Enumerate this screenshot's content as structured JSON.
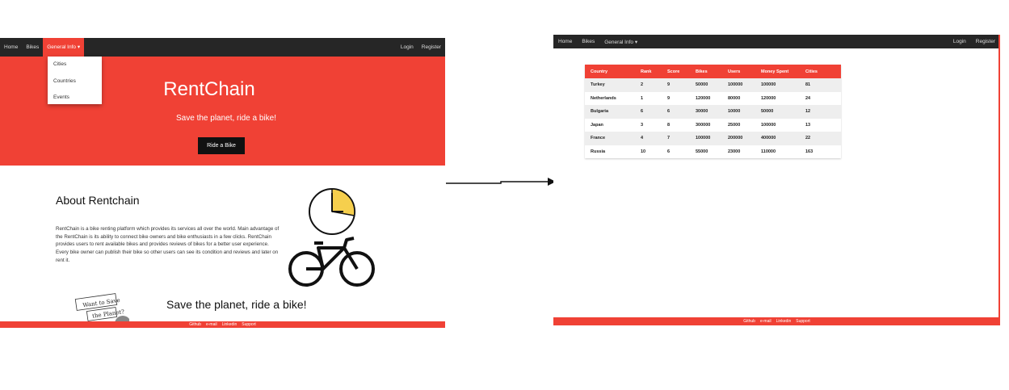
{
  "left": {
    "nav": {
      "items": [
        "Home",
        "Bikes",
        "General Info ▾"
      ],
      "right": [
        "Login",
        "Register"
      ]
    },
    "dropdown": [
      "Cities",
      "Countries",
      "Events"
    ],
    "hero": {
      "title": "RentChain",
      "subtitle": "Save the planet, ride a bike!",
      "button": "Ride a Bike"
    },
    "about": {
      "title": "About Rentchain",
      "text": "RentChain is a bike renting platform which provides its services all over the world. Main advantage of the RentChain is its ability to connect bike owners and bike enthusiasts in a few clicks. RentChain provides users to rent available bikes and provides reviews of bikes for a better user experience. Every bike owner can publish their bike so other users can see its condition and reviews and later on rent it."
    },
    "stamp": [
      "Want to Save",
      "the Planet?"
    ],
    "tagline": "Save the planet, ride a bike!",
    "footer": [
      "Github",
      "e-mail",
      "Linkedin",
      "Support"
    ]
  },
  "right": {
    "nav": {
      "items": [
        "Home",
        "Bikes",
        "General Info ▾"
      ],
      "right": [
        "Login",
        "Register"
      ]
    },
    "table": {
      "columns": [
        "Country",
        "Rank",
        "Score",
        "Bikes",
        "Users",
        "Money Spent",
        "Cities"
      ],
      "rows": [
        [
          "Turkey",
          "2",
          "9",
          "50000",
          "100000",
          "100000",
          "81"
        ],
        [
          "Netherlands",
          "1",
          "9",
          "120000",
          "80000",
          "120000",
          "24"
        ],
        [
          "Bulgaria",
          "6",
          "6",
          "30000",
          "10000",
          "50000",
          "12"
        ],
        [
          "Japan",
          "3",
          "8",
          "300000",
          "25000",
          "100000",
          "13"
        ],
        [
          "France",
          "4",
          "7",
          "100000",
          "200000",
          "400000",
          "22"
        ],
        [
          "Russia",
          "10",
          "6",
          "55000",
          "23000",
          "110000",
          "163"
        ]
      ]
    },
    "footer": [
      "Github",
      "e-mail",
      "Linkedin",
      "Support"
    ]
  },
  "colors": {
    "accent": "#f04135",
    "navbar": "#262626",
    "clock_fill": "#f6cf4d"
  }
}
